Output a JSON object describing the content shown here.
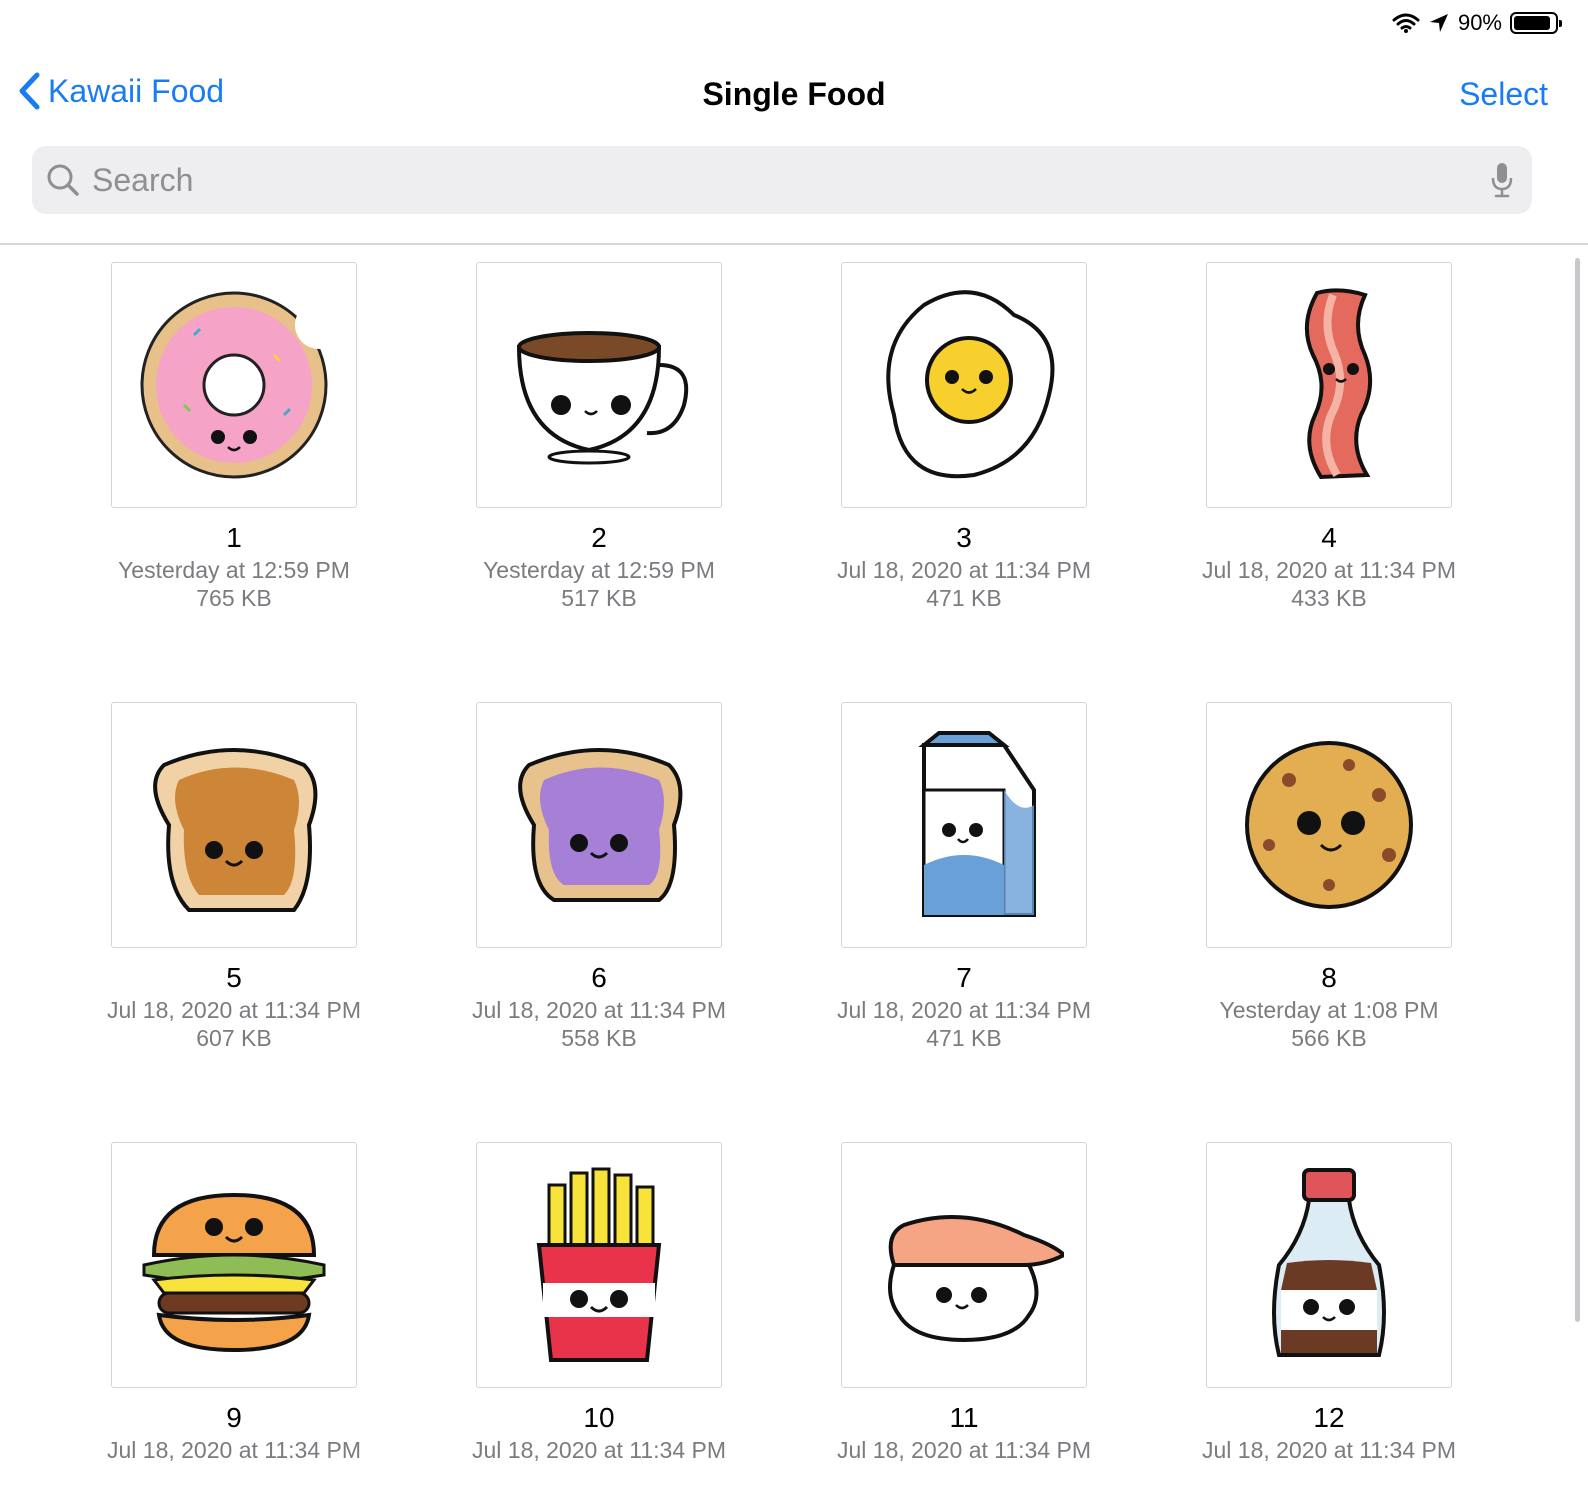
{
  "status": {
    "battery": "90%",
    "battery_level": 0.9
  },
  "nav": {
    "back_label": "Kawaii Food",
    "title": "Single Food",
    "select_label": "Select"
  },
  "search": {
    "placeholder": "Search",
    "value": ""
  },
  "colors": {
    "accent": "#1a7cf5"
  },
  "items": [
    {
      "name": "1",
      "date": "Yesterday at 12:59 PM",
      "size": "765 KB",
      "icon": "donut-icon"
    },
    {
      "name": "2",
      "date": "Yesterday at 12:59 PM",
      "size": "517 KB",
      "icon": "coffee-cup-icon"
    },
    {
      "name": "3",
      "date": "Jul 18, 2020 at 11:34 PM",
      "size": "471 KB",
      "icon": "fried-egg-icon"
    },
    {
      "name": "4",
      "date": "Jul 18, 2020 at 11:34 PM",
      "size": "433 KB",
      "icon": "bacon-icon"
    },
    {
      "name": "5",
      "date": "Jul 18, 2020 at 11:34 PM",
      "size": "607 KB",
      "icon": "peanut-butter-toast-icon"
    },
    {
      "name": "6",
      "date": "Jul 18, 2020 at 11:34 PM",
      "size": "558 KB",
      "icon": "jelly-toast-icon"
    },
    {
      "name": "7",
      "date": "Jul 18, 2020 at 11:34 PM",
      "size": "471 KB",
      "icon": "milk-carton-icon"
    },
    {
      "name": "8",
      "date": "Yesterday at 1:08 PM",
      "size": "566 KB",
      "icon": "cookie-icon"
    },
    {
      "name": "9",
      "date": "Jul 18, 2020 at 11:34 PM",
      "size": "",
      "icon": "burger-icon"
    },
    {
      "name": "10",
      "date": "Jul 18, 2020 at 11:34 PM",
      "size": "",
      "icon": "fries-icon"
    },
    {
      "name": "11",
      "date": "Jul 18, 2020 at 11:34 PM",
      "size": "",
      "icon": "sushi-icon"
    },
    {
      "name": "12",
      "date": "Jul 18, 2020 at 11:34 PM",
      "size": "",
      "icon": "soy-sauce-icon"
    }
  ]
}
